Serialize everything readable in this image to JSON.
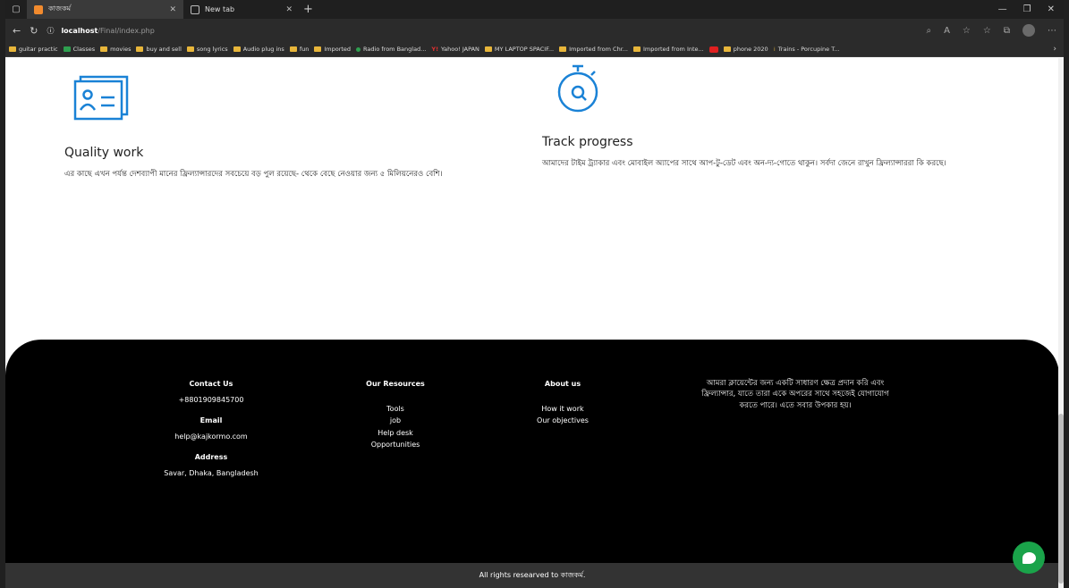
{
  "browser": {
    "tabs": [
      {
        "title": "কাজকর্ম",
        "active": true
      },
      {
        "title": "New tab",
        "active": false
      }
    ],
    "address": {
      "host": "localhost",
      "path": "/Final/index.php"
    },
    "bookmarks": [
      "guitar practic",
      "Classes",
      "movies",
      "buy and sell",
      "song lyrics",
      "Audio plug ins",
      "fun",
      "Imported",
      "Radio from Banglad...",
      "Yahoo! JAPAN",
      "MY LAPTOP SPACIF...",
      "Imported from Chr...",
      "Imported from Inte...",
      "",
      "phone 2020",
      "Trains - Porcupine T..."
    ]
  },
  "features": [
    {
      "title": "Quality work",
      "icon": "id-card-icon",
      "description": "এর কাছে এখন পর্যন্ত দেশব্যাপী মানের ফ্রিল্যান্সারদের সবচেয়ে বড় পুল রয়েছে- থেকে বেছে নেওয়ার জন্য ৫ মিলিয়নেরও বেশি।"
    },
    {
      "title": "Track progress",
      "icon": "stopwatch-icon",
      "description": "আমাদের টাইম ট্র্যাকার এবং মোবাইল অ্যাপের সাথে আপ-টু-ডেট এবং অন-দ্য-গোতে থাকুন। সর্বদা জেনে রাখুন ফ্রিল্যান্সাররা কি করছে।"
    }
  ],
  "footer": {
    "contact": {
      "heading": "Contact Us",
      "phone": "+8801909845700",
      "email_label": "Email",
      "email": "help@kajkormo.com",
      "address_label": "Address",
      "address": "Savar, Dhaka, Bangladesh"
    },
    "resources": {
      "heading": "Our Resources",
      "links": [
        "Tools",
        "job",
        "Help desk",
        "Opportunities"
      ]
    },
    "about": {
      "heading": "About us",
      "links": [
        "How it work",
        "Our objectives"
      ]
    },
    "about_text": "আমরা ক্লায়েন্টের জন্য একটি সাধারণ ক্ষেত্র প্রদান করি এবং ফ্রিল্যান্সার, যাতে তারা একে অপরের সাথে সহজেই যোগাযোগ করতে পারে। এতে সবার উপকার হয়।",
    "copyright": "All rights researved to কাজকর্ম."
  },
  "colors": {
    "accent_blue": "#1a82d6",
    "footer_bg": "#000000",
    "copyright_bg": "#333333",
    "chat_green": "#1aa34a"
  }
}
